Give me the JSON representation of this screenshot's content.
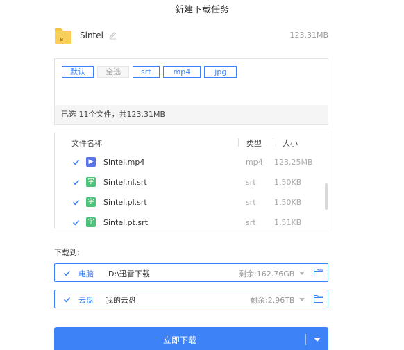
{
  "title": "新建下载任务",
  "file": {
    "name": "Sintel",
    "size": "123.31MB",
    "icon_label": "BT"
  },
  "filters": {
    "tags": [
      "默认",
      "全选",
      "srt",
      "mp4",
      "jpg"
    ],
    "summary": "已选 11个文件，共123.31MB"
  },
  "table": {
    "headers": {
      "name": "文件名称",
      "type": "类型",
      "size": "大小"
    },
    "rows": [
      {
        "name": "Sintel.mp4",
        "type": "mp4",
        "size": "123.25MB",
        "icon": "▶",
        "kind": "video",
        "checked": true
      },
      {
        "name": "Sintel.nl.srt",
        "type": "srt",
        "size": "1.50KB",
        "icon": "字",
        "kind": "sub",
        "checked": true
      },
      {
        "name": "Sintel.pl.srt",
        "type": "srt",
        "size": "1.50KB",
        "icon": "字",
        "kind": "sub",
        "checked": true
      },
      {
        "name": "Sintel.pt.srt",
        "type": "srt",
        "size": "1.51KB",
        "icon": "字",
        "kind": "sub",
        "checked": true
      }
    ]
  },
  "download_to_label": "下载到:",
  "destinations": [
    {
      "name": "电脑",
      "path": "D:\\迅雷下载",
      "space": "剩余:162.76GB",
      "checked": true
    },
    {
      "name": "云盘",
      "path": "我的云盘",
      "space": "剩余:2.96TB",
      "checked": true
    }
  ],
  "download_button": "立即下载",
  "colors": {
    "accent": "#3d82f6",
    "folder": "#f6c34a",
    "video_icon": "#5a74e8",
    "subtitle_icon": "#4cc27a"
  }
}
